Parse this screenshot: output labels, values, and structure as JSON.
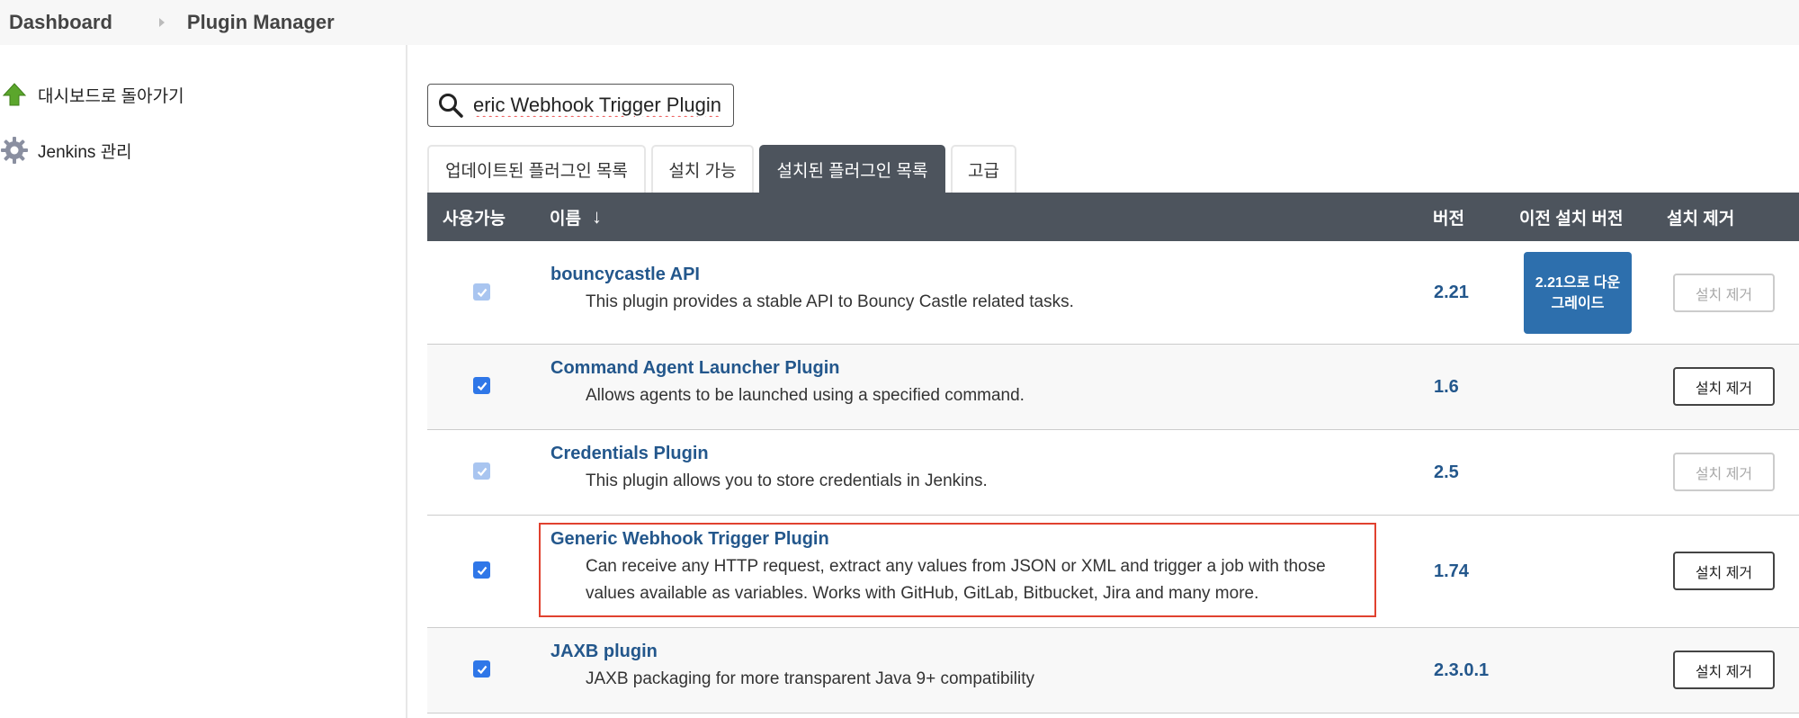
{
  "breadcrumb": {
    "items": [
      "Dashboard",
      "Plugin Manager"
    ]
  },
  "sidebar": {
    "items": [
      {
        "label": "대시보드로 돌아가기",
        "icon": "up-arrow-icon"
      },
      {
        "label": "Jenkins 관리",
        "icon": "gear-icon"
      }
    ]
  },
  "search": {
    "value": "eric Webhook Trigger Plugin",
    "icon": "search-icon"
  },
  "tabs": [
    {
      "label": "업데이트된 플러그인 목록",
      "active": false
    },
    {
      "label": "설치 가능",
      "active": false
    },
    {
      "label": "설치된 플러그인 목록",
      "active": true
    },
    {
      "label": "고급",
      "active": false
    }
  ],
  "table": {
    "headers": {
      "enabled": "사용가능",
      "name": "이름",
      "name_sort": "↓",
      "version": "버전",
      "previous": "이전 설치 버전",
      "uninstall": "설치 제거"
    },
    "rows": [
      {
        "name": "bouncycastle API",
        "description": "This plugin provides a stable API to Bouncy Castle related tasks.",
        "version": "2.21",
        "enabled": true,
        "checkbox_disabled": true,
        "downgrade": "2.21으로 다운그레이드",
        "uninstall": "설치 제거",
        "uninstall_disabled": true
      },
      {
        "name": "Command Agent Launcher Plugin",
        "description": "Allows agents to be launched using a specified command.",
        "version": "1.6",
        "enabled": true,
        "checkbox_disabled": false,
        "uninstall": "설치 제거",
        "uninstall_disabled": false
      },
      {
        "name": "Credentials Plugin",
        "description": "This plugin allows you to store credentials in Jenkins.",
        "version": "2.5",
        "enabled": true,
        "checkbox_disabled": true,
        "uninstall": "설치 제거",
        "uninstall_disabled": true
      },
      {
        "name": "Generic Webhook Trigger Plugin",
        "description_line1": "Can receive any HTTP request, extract any values from JSON or XML and trigger a job with those",
        "description_line2": "values available as variables. Works with GitHub, GitLab, Bitbucket, Jira and many more.",
        "version": "1.74",
        "enabled": true,
        "checkbox_disabled": false,
        "uninstall": "설치 제거",
        "uninstall_disabled": false,
        "highlighted": true
      },
      {
        "name": "JAXB plugin",
        "description": "JAXB packaging for more transparent Java 9+ compatibility",
        "version": "2.3.0.1",
        "enabled": true,
        "checkbox_disabled": false,
        "uninstall": "설치 제거",
        "uninstall_disabled": false
      }
    ]
  },
  "colors": {
    "header_bg": "#4d545d",
    "link": "#23578c",
    "checkbox": "#2f77e8",
    "downgrade_bg": "#2d6fad",
    "highlight": "#e0412f"
  }
}
